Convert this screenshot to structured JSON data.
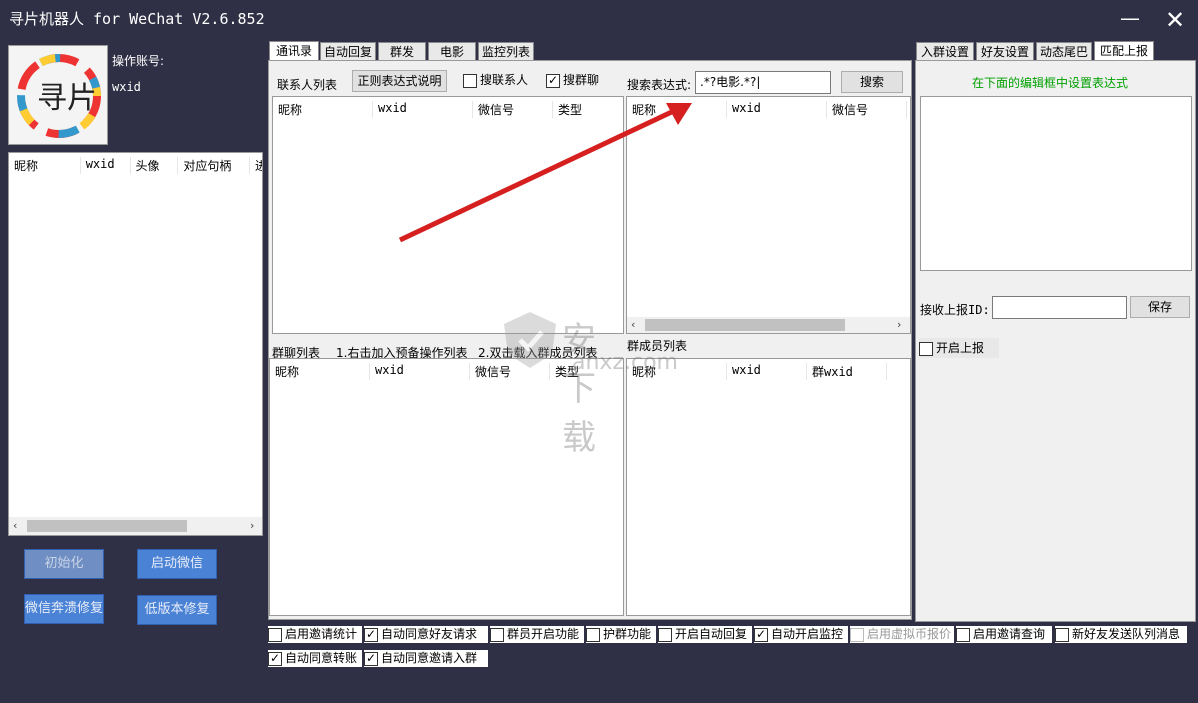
{
  "window": {
    "title": "寻片机器人 for WeChat V2.6.852"
  },
  "account": {
    "label": "操作账号:",
    "wxid": "wxid",
    "logo_text": "寻片"
  },
  "left_table": {
    "headers": [
      "昵称",
      "wxid",
      "头像",
      "对应句柄",
      "进"
    ]
  },
  "left_buttons": {
    "init": "初始化",
    "start_wechat": "启动微信",
    "crash_fix": "微信奔溃修复",
    "low_ver_fix": "低版本修复"
  },
  "mid_tabs": [
    "通讯录",
    "自动回复",
    "群发",
    "电影",
    "监控列表"
  ],
  "contacts": {
    "title": "联系人列表",
    "regex_help": "正则表达式说明",
    "search_contacts": "搜联系人",
    "search_groups": "搜群聊",
    "headers": [
      "昵称",
      "wxid",
      "微信号",
      "类型"
    ]
  },
  "search": {
    "label": "搜索表达式:",
    "value": ".*?电影.*?|",
    "button": "搜索",
    "headers": [
      "昵称",
      "wxid",
      "微信号"
    ]
  },
  "group_list": {
    "title": "群聊列表",
    "hint1": "1.右击加入预备操作列表",
    "hint2": "2.双击载入群成员列表",
    "headers": [
      "昵称",
      "wxid",
      "微信号",
      "类型"
    ]
  },
  "members": {
    "title": "群成员列表",
    "headers": [
      "昵称",
      "wxid",
      "群wxid"
    ]
  },
  "right_tabs": [
    "入群设置",
    "好友设置",
    "动态尾巴",
    "匹配上报"
  ],
  "report": {
    "hint": "在下面的编辑框中设置表达式",
    "id_label": "接收上报ID:",
    "save": "保存",
    "enable": "开启上报"
  },
  "bottom_options": [
    {
      "label": "启用邀请统计",
      "checked": false
    },
    {
      "label": "自动同意好友请求",
      "checked": true
    },
    {
      "label": "群员开启功能",
      "checked": false
    },
    {
      "label": "护群功能",
      "checked": false
    },
    {
      "label": "开启自动回复",
      "checked": false
    },
    {
      "label": "自动开启监控",
      "checked": true
    },
    {
      "label": "启用虚拟币报价",
      "checked": false
    },
    {
      "label": "启用邀请查询",
      "checked": false
    },
    {
      "label": "新好友发送队列消息",
      "checked": false
    },
    {
      "label": "自动同意转账",
      "checked": true
    },
    {
      "label": "自动同意邀请入群",
      "checked": true
    }
  ],
  "watermark": {
    "text": "安下载",
    "domain": "anxz.com"
  },
  "colors": {
    "bg": "#2f2f45",
    "button_blue": "#4a82d6",
    "hint_green": "#00a000",
    "arrow_red": "#d62020"
  }
}
